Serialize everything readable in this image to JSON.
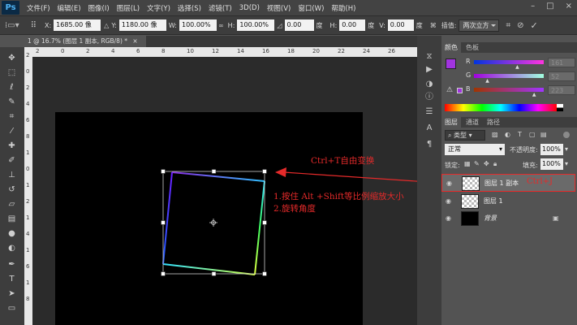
{
  "app": {
    "logo": "Ps"
  },
  "menu": [
    "文件(F)",
    "编辑(E)",
    "图像(I)",
    "图层(L)",
    "文字(Y)",
    "选择(S)",
    "滤镜(T)",
    "3D(D)",
    "视图(V)",
    "窗口(W)",
    "帮助(H)"
  ],
  "window_controls": [
    "–",
    "□",
    "×"
  ],
  "options": {
    "x_label": "X:",
    "x_value": "1685.00 像",
    "y_label": "Y:",
    "y_value": "1180.00 像",
    "w_label": "W:",
    "w_value": "100.00%",
    "h_label": "H:",
    "h_value": "100.00%",
    "angle_value": "0.00",
    "angle_unit": "度",
    "hskew_label": "H:",
    "hskew_value": "0.00",
    "hskew_unit": "度",
    "vskew_label": "V:",
    "vskew_value": "0.00",
    "vskew_unit": "度",
    "interp_label": "插值:",
    "interp_value": "两次立方"
  },
  "document_tab": {
    "title": "1 @ 16.7% (图层 1 副本, RGB/8) *",
    "close": "×"
  },
  "ruler_top": [
    "2",
    "0",
    "2",
    "4",
    "6",
    "8",
    "10",
    "12",
    "14",
    "16",
    "18",
    "20",
    "22",
    "24",
    "26"
  ],
  "ruler_left": [
    "2",
    "0",
    "2",
    "4",
    "6",
    "8",
    "1",
    "0",
    "1",
    "2",
    "1",
    "4",
    "1",
    "6",
    "1",
    "8"
  ],
  "color_panel": {
    "tabs": [
      "颜色",
      "色板"
    ],
    "channels": [
      {
        "label": "R",
        "value": "161",
        "pos": 0.63
      },
      {
        "label": "G",
        "value": "52",
        "pos": 0.2
      },
      {
        "label": "B",
        "value": "223",
        "pos": 0.87
      }
    ],
    "foreground_color": "#a134df",
    "background_color": "#ffffff",
    "warning": "⚠"
  },
  "layers_panel": {
    "tabs": [
      "图层",
      "通道",
      "路径"
    ],
    "filter_label": "类型",
    "blend_mode": "正常",
    "opacity_label": "不透明度:",
    "opacity_value": "100%",
    "lock_label": "锁定:",
    "fill_label": "填充:",
    "fill_value": "100%",
    "layers": [
      {
        "name": "图层 1 副本",
        "selected": true
      },
      {
        "name": "图层 1",
        "selected": false
      },
      {
        "name": "背景",
        "selected": false
      }
    ],
    "selected_tag": "Ctrl+J"
  },
  "annotations": {
    "title": "Ctrl+T自由变换",
    "line1": "1.按住 Alt +Shift等比例缩放大小",
    "line2": "2.旋转角度"
  },
  "colors": {
    "accent_red": "#e52a2a",
    "selection_blue": "#3d7bd6"
  }
}
